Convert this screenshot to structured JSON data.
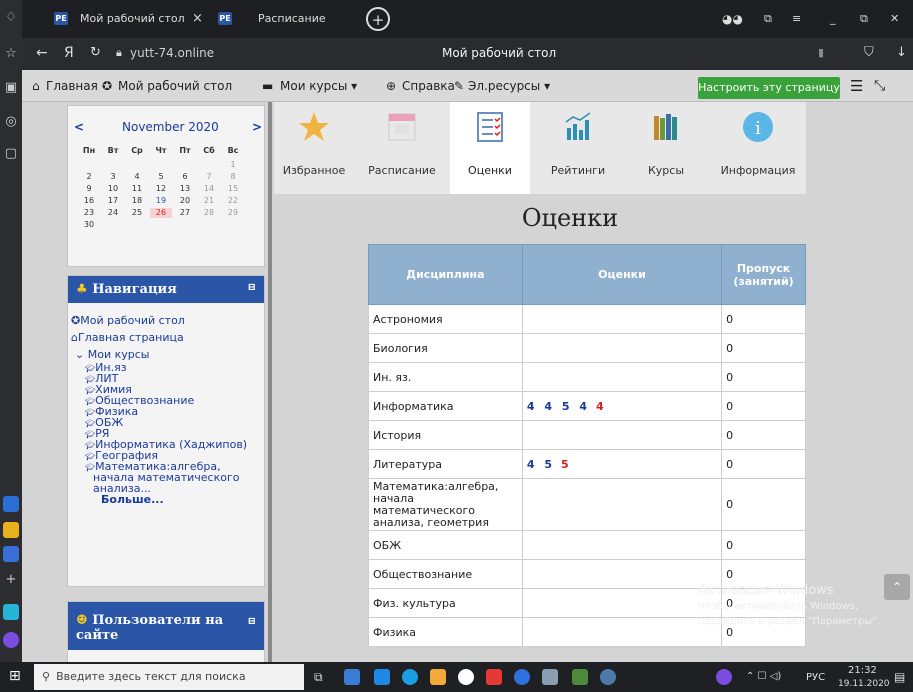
{
  "browser": {
    "tabs": [
      {
        "favicon": "РЕ",
        "title": "Мой рабочий стол",
        "close": "×"
      },
      {
        "favicon": "РЕ",
        "title": "Расписание"
      }
    ],
    "new_tab": "+",
    "address": "yutt-74.online",
    "page_title": "Мой рабочий стол"
  },
  "nav": {
    "items": [
      "Главная",
      "Мой рабочий стол",
      "Мои курсы ▾",
      "Справка",
      "Эл.ресурсы ▾"
    ],
    "customize": "Настроить эту страницу"
  },
  "calendar": {
    "month": "November 2020",
    "prev": "<",
    "next": ">",
    "weekdays": [
      "Пн",
      "Вт",
      "Ср",
      "Чт",
      "Пт",
      "Сб",
      "Вс"
    ],
    "weeks": [
      [
        "",
        "",
        "",
        "",
        "",
        "",
        "1"
      ],
      [
        "2",
        "3",
        "4",
        "5",
        "6",
        "7",
        "8"
      ],
      [
        "9",
        "10",
        "11",
        "12",
        "13",
        "14",
        "15"
      ],
      [
        "16",
        "17",
        "18",
        "19",
        "20",
        "21",
        "22"
      ],
      [
        "23",
        "24",
        "25",
        "26",
        "27",
        "28",
        "29"
      ],
      [
        "30",
        "",
        "",
        "",
        "",
        "",
        ""
      ]
    ]
  },
  "navigation": {
    "title": "Навигация",
    "links": [
      "Мой рабочий стол",
      "Главная страница"
    ],
    "courses_label": "Мои курсы",
    "courses": [
      "Ин.яз",
      "ЛИТ",
      "Химия",
      "Обществознание",
      "Физика",
      "ОБЖ",
      "РЯ",
      "Информатика (Хаджипов)",
      "География",
      "Математика:алгебра,",
      "начала математического",
      "анализа..."
    ],
    "more": "Больше..."
  },
  "users": {
    "title": "Пользователи на",
    "title2": "сайте"
  },
  "icons": [
    {
      "label": "Избранное",
      "icon": "star-icon"
    },
    {
      "label": "Расписание",
      "icon": "calendar-icon"
    },
    {
      "label": "Оценки",
      "icon": "checklist-icon"
    },
    {
      "label": "Рейтинги",
      "icon": "chart-icon"
    },
    {
      "label": "Курсы",
      "icon": "books-icon"
    },
    {
      "label": "Информация",
      "icon": "info-icon"
    }
  ],
  "grades": {
    "title": "Оценки",
    "headers": [
      "Дисциплина",
      "Оценки",
      "Пропуск",
      "(занятий)"
    ],
    "rows": [
      {
        "subject": "Астрономия",
        "g1": "",
        "g2": "",
        "absent": "0"
      },
      {
        "subject": "Биология",
        "g1": "",
        "g2": "",
        "absent": "0"
      },
      {
        "subject": "Ин. яз.",
        "g1": "",
        "g2": "",
        "absent": "0"
      },
      {
        "subject": "Информатика",
        "g1": "4 4 5 4",
        "g2": "4",
        "absent": "0"
      },
      {
        "subject": "История",
        "g1": "",
        "g2": "",
        "absent": "0"
      },
      {
        "subject": "Литература",
        "g1": "4 5",
        "g2": "5",
        "absent": "0"
      },
      {
        "subject": "Математика:алгебра, начала математического анализа, геометрия",
        "g1": "",
        "g2": "",
        "absent": "0"
      },
      {
        "subject": "ОБЖ",
        "g1": "",
        "g2": "",
        "absent": "0"
      },
      {
        "subject": "Обществознание",
        "g1": "",
        "g2": "",
        "absent": "0"
      },
      {
        "subject": "Физ. культура",
        "g1": "",
        "g2": "",
        "absent": "0"
      },
      {
        "subject": "Физика",
        "g1": "",
        "g2": "",
        "absent": "0"
      }
    ]
  },
  "watermark": {
    "line1": "Активация Windows",
    "line2": "Чтобы активировать Windows,",
    "line3": "перейдите в раздел \"Параметры\"."
  },
  "taskbar": {
    "search": "Введите здесь текст для поиска",
    "lang": "РУС",
    "time": "21:32",
    "date": "19.11.2020"
  },
  "colors": {
    "accent": "#2b55a6",
    "table_header": "#8fb0cf",
    "green": "#3aa23a",
    "grade_red": "#d4201f"
  }
}
